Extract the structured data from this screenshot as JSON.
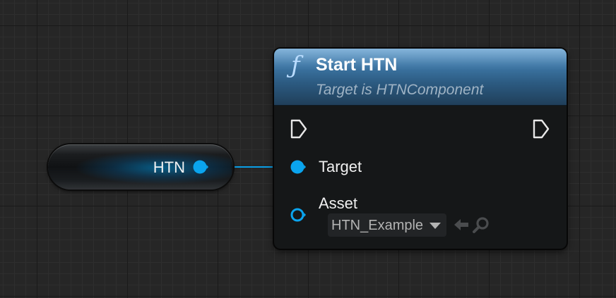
{
  "variable_node": {
    "label": "HTN"
  },
  "function_node": {
    "icon": "function-icon",
    "icon_glyph": "ƒ",
    "title": "Start HTN",
    "subtitle": "Target is HTNComponent",
    "header_color": "#3f79a8"
  },
  "pins": {
    "target_label": "Target",
    "asset_label": "Asset",
    "asset_value": "HTN_Example"
  },
  "colors": {
    "object_pin": "#0aa4ee",
    "asset_pin": "#0aa4ee",
    "exec_pin": "#e8e8e8",
    "wire": "#0a9ee6"
  },
  "icons": {
    "exec_in": "exec-input-pin-icon",
    "exec_out": "exec-output-pin-icon",
    "use_selected": "use-selected-asset-arrow-icon",
    "browse": "browse-asset-search-icon",
    "dropdown": "chevron-down-icon"
  }
}
